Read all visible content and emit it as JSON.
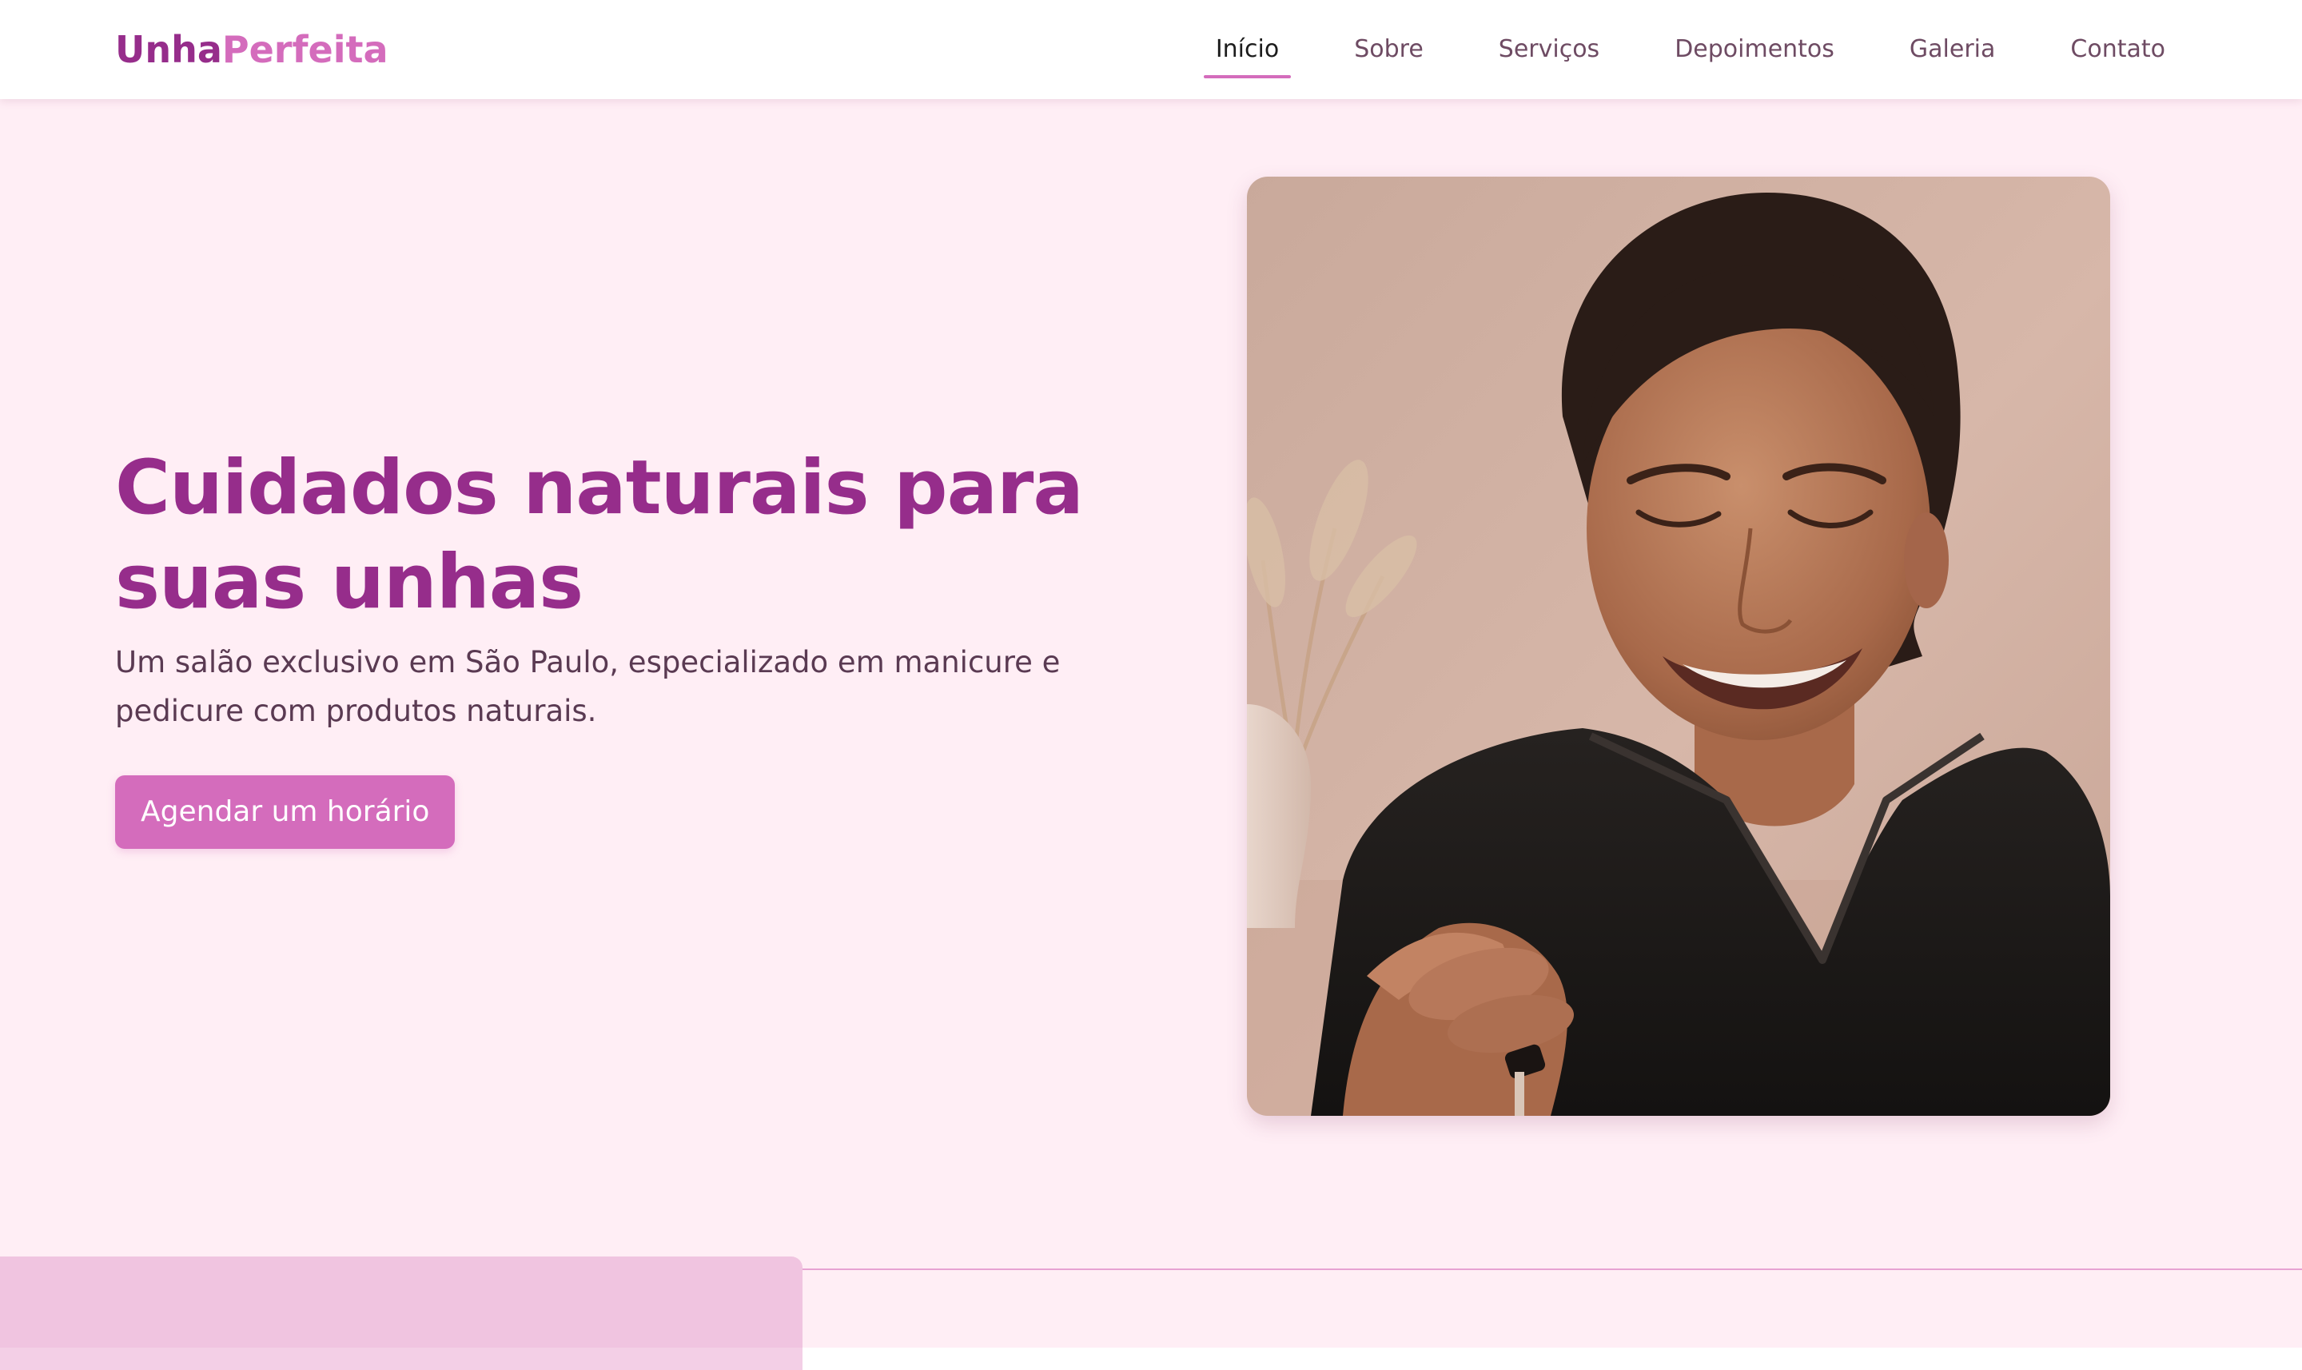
{
  "brand": {
    "logo_part_1": "Unha",
    "logo_part_2": "Perfeita"
  },
  "nav": {
    "items": [
      {
        "label": "Início",
        "active": true
      },
      {
        "label": "Sobre",
        "active": false
      },
      {
        "label": "Serviços",
        "active": false
      },
      {
        "label": "Depoimentos",
        "active": false
      },
      {
        "label": "Galeria",
        "active": false
      },
      {
        "label": "Contato",
        "active": false
      }
    ]
  },
  "hero": {
    "title": "Cuidados naturais para suas unhas",
    "subtitle": "Um salão exclusivo em São Paulo, especializado em manicure e pedicure com produtos naturais.",
    "cta_label": "Agendar um horário"
  },
  "colors": {
    "brand_primary": "#962d8b",
    "brand_accent": "#d46cbc",
    "page_background": "#ffeef5",
    "text_body": "#5a3a52",
    "nav_text": "#6e4b63"
  },
  "icons": {
    "hero_photo": "manicurist-portrait-photo"
  }
}
